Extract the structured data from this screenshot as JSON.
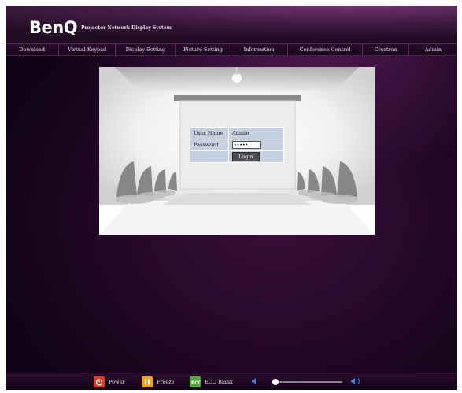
{
  "header": {
    "logo_text": "BenQ",
    "subtitle": "Projector Network Display System"
  },
  "nav": {
    "items": [
      {
        "label": "Download"
      },
      {
        "label": "Virtual Keypad"
      },
      {
        "label": "Display Setting"
      },
      {
        "label": "Picture Setting"
      },
      {
        "label": "Information"
      },
      {
        "label": "Conference Control"
      },
      {
        "label": "Crestron"
      },
      {
        "label": "Admin"
      }
    ]
  },
  "login": {
    "username_label": "User Name",
    "username_value": "Admin",
    "password_label": "Password",
    "password_value": "•••••",
    "login_label": "Login"
  },
  "footer": {
    "power_label": "Power",
    "freeze_label": "Freeze",
    "eco_blank_label": "ECO Blank",
    "volume_level": 0.05
  },
  "colors": {
    "power": "#e23a1f",
    "freeze": "#f0a21c",
    "eco_blank": "#4ea83a",
    "volume_icon": "#3c7be0"
  }
}
